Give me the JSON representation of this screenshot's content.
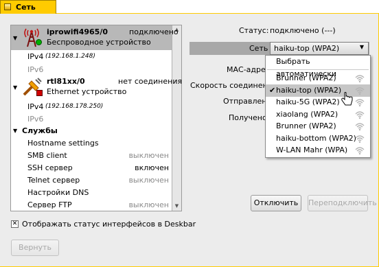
{
  "window": {
    "title": "Сеть"
  },
  "interfaces": [
    {
      "name": "iprowifi4965/0",
      "status": "подключено",
      "type": "Беспроводное устройство",
      "ipv4_label": "IPv4",
      "ipv4": "(192.168.1.248)",
      "ipv6_label": "IPv6",
      "status_color": "#00b000"
    },
    {
      "name": "rtl81xx/0",
      "status": "нет соединения",
      "type": "Ethernet устройство",
      "ipv4_label": "IPv4",
      "ipv4": "(192.168.178.250)",
      "ipv6_label": "IPv6",
      "status_color": "#d00000"
    }
  ],
  "services": {
    "header": "Службы",
    "items": [
      {
        "name": "Hostname settings",
        "state": ""
      },
      {
        "name": "SMB client",
        "state": "выключен"
      },
      {
        "name": "SSH сервер",
        "state": "включен"
      },
      {
        "name": "Telnet сервер",
        "state": "выключен"
      },
      {
        "name": "Настройки DNS",
        "state": ""
      },
      {
        "name": "Сервер FTP",
        "state": "выключен"
      }
    ]
  },
  "details": {
    "status_label": "Статус:",
    "status_value": "подключено (---)",
    "network_label": "Сеть",
    "network_value": "haiku-top (WPA2)",
    "mac_label": "МАС-адрес:",
    "speed_label": "Скорость соединения:",
    "sent_label": "Отправлено:",
    "received_label": "Получено:"
  },
  "network_menu": {
    "auto": "Выбрать автоматически",
    "items": [
      {
        "name": "Brunner (WPA2)",
        "checked": false,
        "highlight": false
      },
      {
        "name": "haiku-top (WPA2)",
        "checked": true,
        "highlight": true
      },
      {
        "name": "haiku-5G (WPA2)",
        "checked": false,
        "highlight": false
      },
      {
        "name": "xiaolang (WPA2)",
        "checked": false,
        "highlight": false
      },
      {
        "name": "Brunner (WPA2)",
        "checked": false,
        "highlight": false
      },
      {
        "name": "haiku-bottom (WPA2)",
        "checked": false,
        "highlight": false
      },
      {
        "name": "W-LAN Mahr (WPA)",
        "checked": false,
        "highlight": false
      }
    ]
  },
  "buttons": {
    "disconnect": "Отключить",
    "reconnect": "Переподключить",
    "revert": "Вернуть"
  },
  "deskbar_checkbox": {
    "label": "Отображать статус интерфейсов в Deskbar",
    "checked": true
  },
  "colors": {
    "tab": "#ffcb00",
    "selection": "#b8b8b8"
  }
}
